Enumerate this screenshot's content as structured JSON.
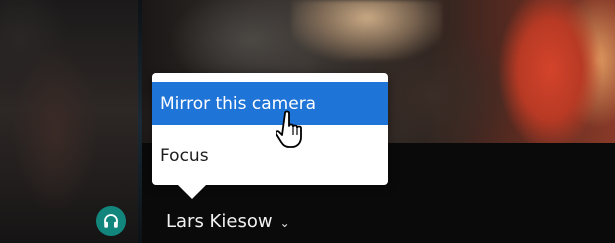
{
  "participant": {
    "name": "Lars Kiesow",
    "caret": "⌄",
    "status_icon": "headset-icon",
    "status_color": "#12867d"
  },
  "context_menu": {
    "items": [
      {
        "label": "Mirror this camera",
        "highlighted": true
      },
      {
        "label": "Focus",
        "highlighted": false
      }
    ],
    "highlight_color": "#1f74d8"
  },
  "cursor": {
    "icon": "hand-pointer-icon"
  }
}
